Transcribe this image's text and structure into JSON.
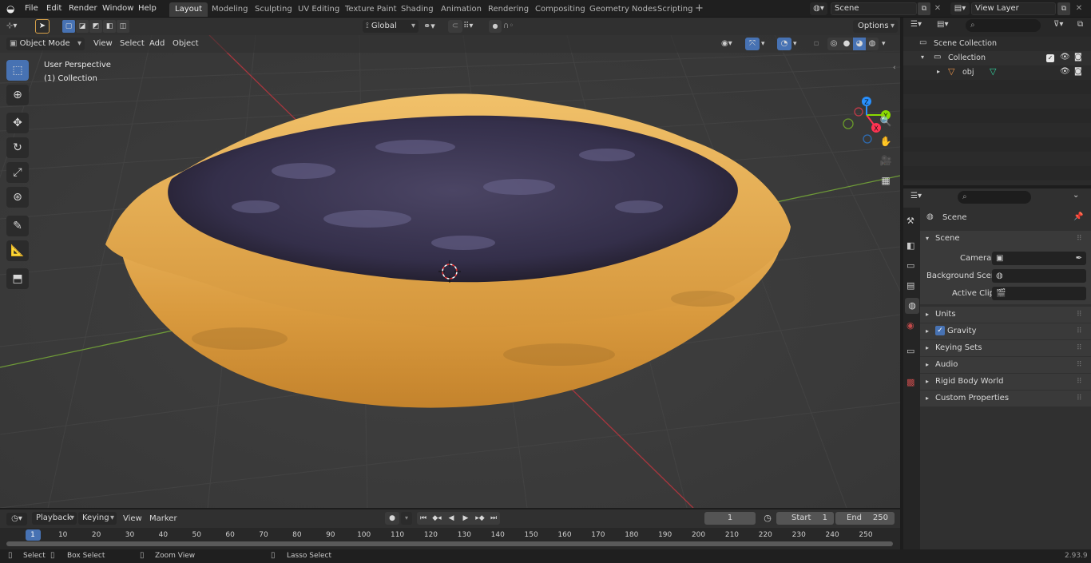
{
  "menu": [
    "File",
    "Edit",
    "Render",
    "Window",
    "Help"
  ],
  "workspaces": [
    "Layout",
    "Modeling",
    "Sculpting",
    "UV Editing",
    "Texture Paint",
    "Shading",
    "Animation",
    "Rendering",
    "Compositing",
    "Geometry Nodes",
    "Scripting"
  ],
  "active_workspace": "Layout",
  "scene_name": "Scene",
  "view_layer": "View Layer",
  "header3d": {
    "mode": "Object Mode",
    "view": "View",
    "select": "Select",
    "add": "Add",
    "object": "Object",
    "transform_orientation": "Global",
    "options": "Options"
  },
  "viewport": {
    "perspective": "User Perspective",
    "collection": "(1) Collection",
    "gizmo": {
      "x": "X",
      "y": "Y",
      "z": "Z"
    }
  },
  "outliner": {
    "scene_collection": "Scene Collection",
    "collection": "Collection",
    "object": "obj"
  },
  "properties": {
    "header": "Scene",
    "panel": "Scene",
    "camera_label": "Camera",
    "background_label": "Background Scene",
    "clip_label": "Active Clip",
    "sections": [
      "Units",
      "Gravity",
      "Keying Sets",
      "Audio",
      "Rigid Body World",
      "Custom Properties"
    ],
    "gravity_checked": true
  },
  "timeline": {
    "playback": "Playback",
    "keying": "Keying",
    "view": "View",
    "marker": "Marker",
    "current_frame": "1",
    "start_label": "Start",
    "start": "1",
    "end_label": "End",
    "end": "250",
    "ticks": [
      "1",
      "10",
      "20",
      "30",
      "40",
      "50",
      "60",
      "70",
      "80",
      "90",
      "100",
      "110",
      "120",
      "130",
      "140",
      "150",
      "160",
      "170",
      "180",
      "190",
      "200",
      "210",
      "220",
      "230",
      "240",
      "250"
    ]
  },
  "status": {
    "select": "Select",
    "box_select": "Box Select",
    "zoom_view": "Zoom View",
    "lasso_select": "Lasso Select",
    "version": "2.93.9"
  },
  "colors": {
    "accent": "#4772b3",
    "x_axis": "#ff3352",
    "y_axis": "#8bdc00",
    "z_axis": "#2890ff"
  }
}
